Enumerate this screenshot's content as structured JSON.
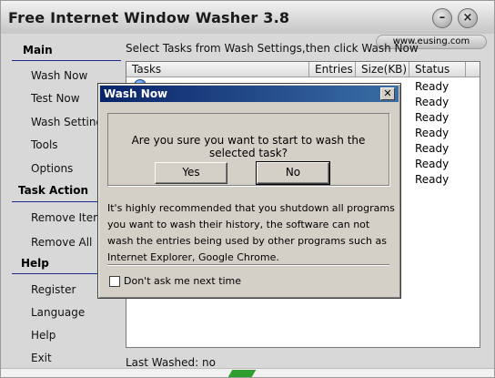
{
  "app": {
    "title": "Free Internet Window Washer 3.8",
    "website": "www.eusing.com",
    "minimize_glyph": "–",
    "close_glyph": "×"
  },
  "sidebar": {
    "sections": [
      {
        "heading": "Main",
        "items": [
          "Wash Now",
          "Test Now",
          "Wash Settings",
          "Tools",
          "Options"
        ]
      },
      {
        "heading": "Task Action",
        "items": [
          "Remove Item",
          "Remove All"
        ]
      },
      {
        "heading": "Help",
        "items": [
          "Register",
          "Language",
          "Help",
          "Exit"
        ]
      }
    ]
  },
  "main": {
    "instruction": "Select Tasks from Wash Settings,then click Wash Now",
    "columns": [
      "Tasks",
      "Entries",
      "Size(KB)",
      "Status"
    ],
    "statuses": [
      "Ready",
      "Ready",
      "Ready",
      "Ready",
      "Ready",
      "Ready",
      "Ready"
    ],
    "last_washed": "Last Washed: no"
  },
  "dialog": {
    "title": "Wash Now",
    "close_glyph": "✕",
    "question": "Are you sure you want to start to wash the selected task?",
    "yes_label": "Yes",
    "no_label": "No",
    "note": "It's highly recommended that you shutdown all programs you want to wash their history, the software can not wash the entries being used by other programs such as Internet Explorer, Google Chrome.",
    "dont_ask_label": "Don't ask me next time",
    "dont_ask_checked": false
  },
  "colors": {
    "dialog_title_start": "#0a246a",
    "dialog_title_end": "#3a6ea5",
    "sidebar_rule": "#1e2a8c"
  }
}
